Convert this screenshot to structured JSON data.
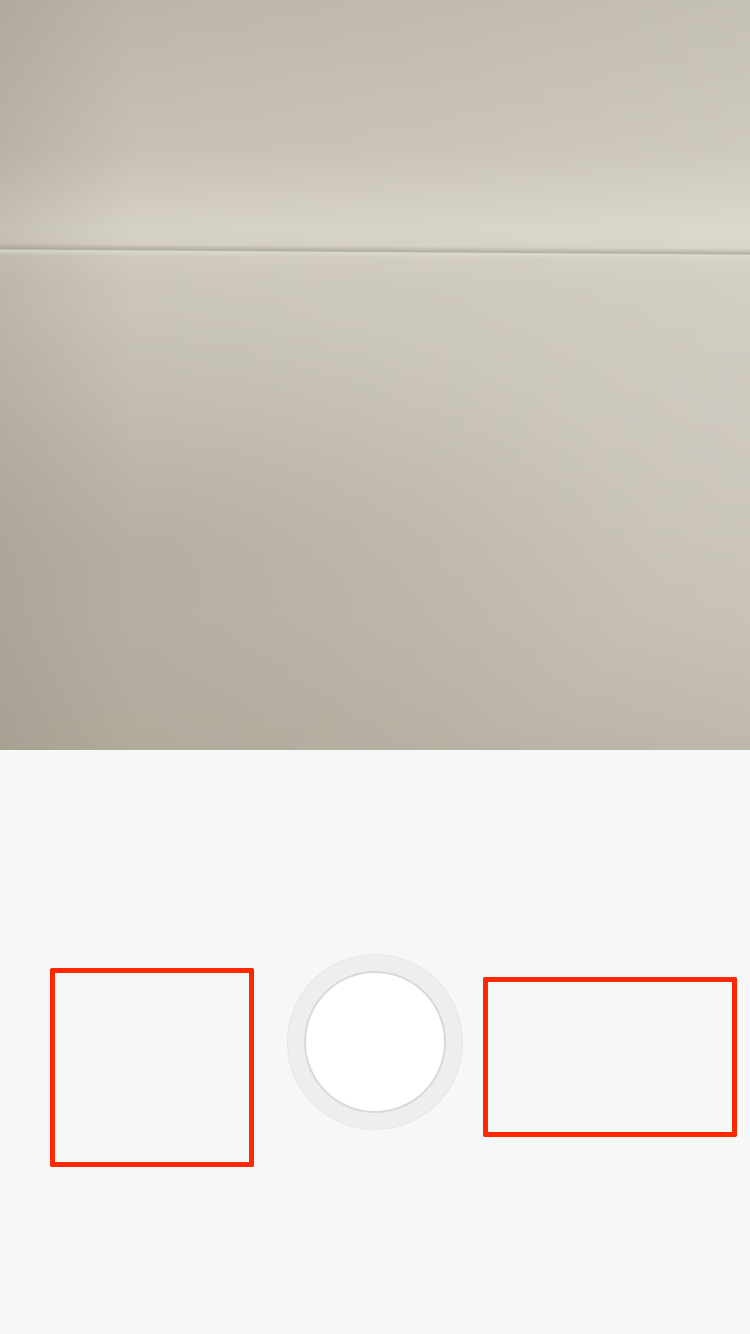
{
  "camera": {
    "preview_label": "",
    "shutter_label": ""
  },
  "controls": {
    "left_slot_label": "",
    "right_slot_label": ""
  },
  "colors": {
    "placeholder_outline": "#ff2600",
    "control_background": "#f6f7f9",
    "shutter_ring": "#eeeeee",
    "shutter_core": "#ffffff"
  }
}
